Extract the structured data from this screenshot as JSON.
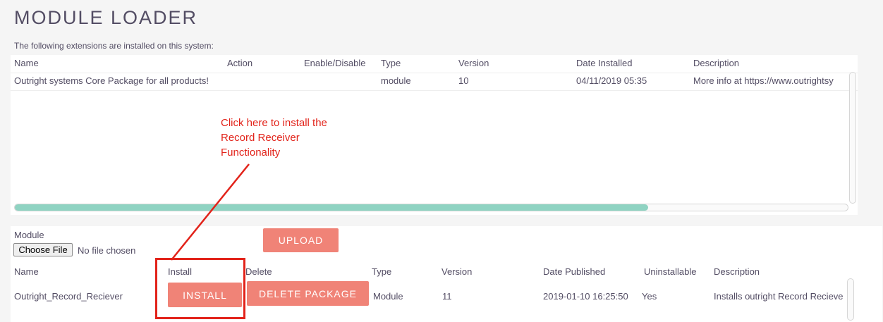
{
  "page": {
    "title": "MODULE LOADER",
    "intro": "The following extensions are installed on this system:"
  },
  "installed": {
    "headers": [
      "Name",
      "Action",
      "Enable/Disable",
      "Type",
      "Version",
      "Date Installed",
      "Description"
    ],
    "rows": [
      {
        "name": "Outright systems Core Package for all products!",
        "action": "",
        "enable": "",
        "type": "module",
        "version": "10",
        "date": "04/11/2019 05:35",
        "description": "More info at https://www.outrightsy"
      }
    ],
    "scroll_progress": 0.76
  },
  "upload": {
    "module_label": "Module",
    "choose_file": "Choose File",
    "file_status": "No file chosen",
    "upload_button": "UPLOAD"
  },
  "packages": {
    "headers": [
      "Name",
      "Install",
      "Delete",
      "Type",
      "Version",
      "Date Published",
      "Uninstallable",
      "Description"
    ],
    "rows": [
      {
        "name": "Outright_Record_Reciever",
        "install_button": "INSTALL",
        "delete_button": "DELETE PACKAGE",
        "type": "Module",
        "version": "11",
        "date": "2019-01-10 16:25:50",
        "uninstallable": "Yes",
        "description": "Installs outright Record Recieve"
      }
    ]
  },
  "annotation": {
    "text_lines": [
      "Click here to install the",
      "Record Receiver",
      "Functionality"
    ],
    "color": "#e2231a"
  },
  "colors": {
    "button": "#f08377",
    "scroll_thumb": "#8fd3c2",
    "text": "#534d64"
  }
}
